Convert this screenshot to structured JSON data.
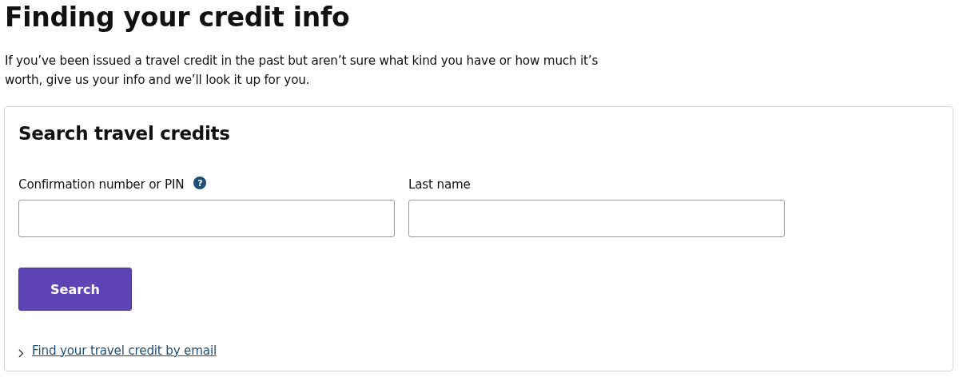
{
  "page": {
    "title": "Finding your credit info",
    "intro": "If you’ve been issued a travel credit in the past but aren’t sure what kind you have or how much it’s worth, give us your info and we’ll look it up for you."
  },
  "card": {
    "title": "Search travel credits",
    "fields": [
      {
        "label": "Confirmation number or PIN",
        "help": "?"
      },
      {
        "label": "Last name"
      }
    ],
    "button": "Search",
    "link": "Find your travel credit by email"
  }
}
